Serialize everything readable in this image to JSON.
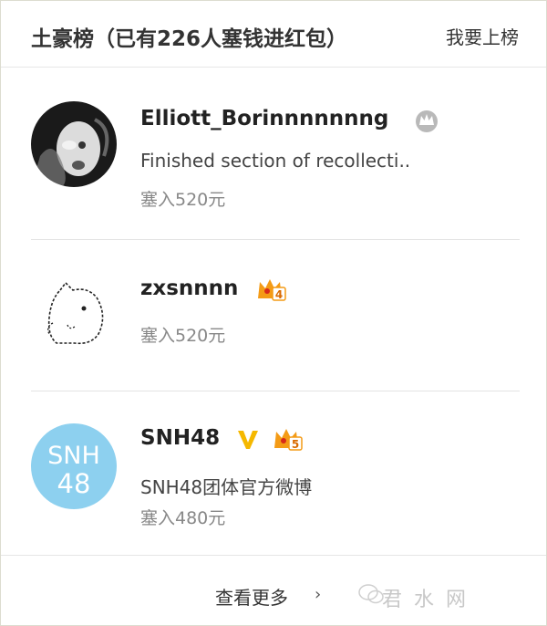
{
  "header": {
    "title": "土豪榜（已有226人塞钱进红包）",
    "action": "我要上榜"
  },
  "entries": [
    {
      "name": "Elliott_Borinnnnnnng",
      "desc": "Finished section of recollecti..",
      "amount": "塞入520元"
    },
    {
      "name": "zxsnnnn",
      "amount": "塞入520元"
    },
    {
      "name": "SNH48",
      "desc": "SNH48团体官方微博",
      "amount": "塞入480元",
      "avatar_text_top": "SNH",
      "avatar_text_bottom": "48"
    }
  ],
  "footer": {
    "more": "查看更多",
    "arrow": "›",
    "watermark": "君 水 网"
  },
  "colors": {
    "verified": "#f5b800",
    "level_badge": "#f49b16",
    "snh_avatar": "#8dd0ef"
  }
}
